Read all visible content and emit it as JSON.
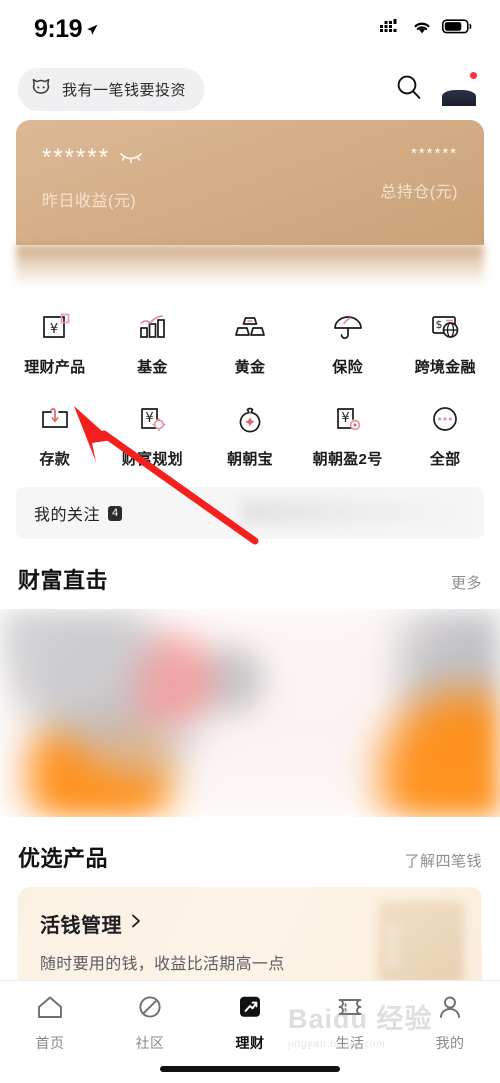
{
  "status_bar": {
    "time": "9:19",
    "location_icon": "location-arrow-icon",
    "signal_icon": "cellular-signal-icon",
    "wifi_icon": "wifi-icon",
    "battery_icon": "battery-icon"
  },
  "top_bar": {
    "search_pill_label": "我有一笔钱要投资",
    "mascot_icon": "cat-mascot-icon",
    "search_icon": "search-icon",
    "avatar_icon": "user-avatar",
    "notification_dot": true
  },
  "hero_card": {
    "masked_value_left": "******",
    "masked_value_right": "******",
    "label_left": "昨日收益(元)",
    "label_right": "总持仓(元)",
    "eye_icon": "eye-hidden-icon",
    "accent_color": "#d3ad85"
  },
  "quick_grid": {
    "rows": [
      [
        {
          "label": "理财产品",
          "icon": "yuan-box-icon"
        },
        {
          "label": "基金",
          "icon": "bar-chart-icon"
        },
        {
          "label": "黄金",
          "icon": "gold-bars-icon"
        },
        {
          "label": "保险",
          "icon": "umbrella-icon"
        },
        {
          "label": "跨境金融",
          "icon": "globe-card-icon"
        }
      ],
      [
        {
          "label": "存款",
          "icon": "deposit-box-icon"
        },
        {
          "label": "财富规划",
          "icon": "yuan-gear-icon"
        },
        {
          "label": "朝朝宝",
          "icon": "money-bag-icon"
        },
        {
          "label": "朝朝盈2号",
          "icon": "yuan-doc-icon"
        },
        {
          "label": "全部",
          "icon": "more-dots-icon"
        }
      ]
    ]
  },
  "follow_strip": {
    "label": "我的关注",
    "badge": "4"
  },
  "wealth_section": {
    "title": "财富直击",
    "more_label": "更多"
  },
  "products_section": {
    "title": "优选产品",
    "more_label": "了解四笔钱",
    "card": {
      "title": "活钱管理",
      "chevron": "chevron-right-icon",
      "subtitle": "随时要用的钱，收益比活期高一点"
    }
  },
  "tabbar": {
    "items": [
      {
        "label": "首页",
        "icon": "home-icon",
        "active": false
      },
      {
        "label": "社区",
        "icon": "community-planet-icon",
        "active": false
      },
      {
        "label": "理财",
        "icon": "finance-trend-icon",
        "active": true
      },
      {
        "label": "生活",
        "icon": "life-ticket-icon",
        "active": false
      },
      {
        "label": "我的",
        "icon": "profile-person-icon",
        "active": false
      }
    ]
  },
  "watermark": {
    "main": "Baidu 经验",
    "sub": "jingyan.baidu.com"
  },
  "annotation": {
    "arrow_color": "#f5201d",
    "points_at": "存款"
  }
}
